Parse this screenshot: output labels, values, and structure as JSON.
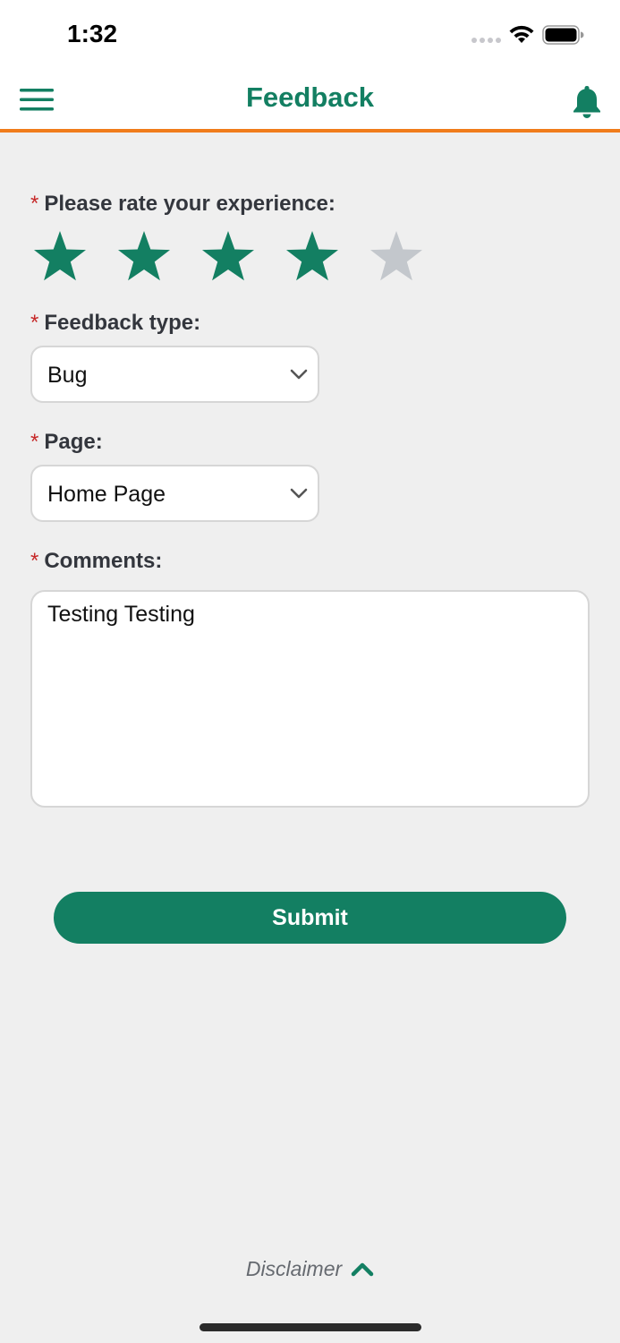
{
  "status_bar": {
    "time": "1:32"
  },
  "header": {
    "title": "Feedback",
    "accent_color": "#137f62",
    "border_color": "#f07c1b"
  },
  "rating": {
    "label": "Please rate your experience:",
    "required_marker": "*",
    "value": 4,
    "max": 5,
    "filled_color": "#137f62",
    "empty_color": "#c3c7cc"
  },
  "feedback_type": {
    "label": "Feedback type:",
    "required_marker": "*",
    "value": "Bug"
  },
  "page": {
    "label": "Page:",
    "required_marker": "*",
    "value": "Home Page"
  },
  "comments": {
    "label": "Comments:",
    "required_marker": "*",
    "value": "Testing Testing"
  },
  "submit": {
    "label": "Submit"
  },
  "footer": {
    "disclaimer_label": "Disclaimer"
  }
}
